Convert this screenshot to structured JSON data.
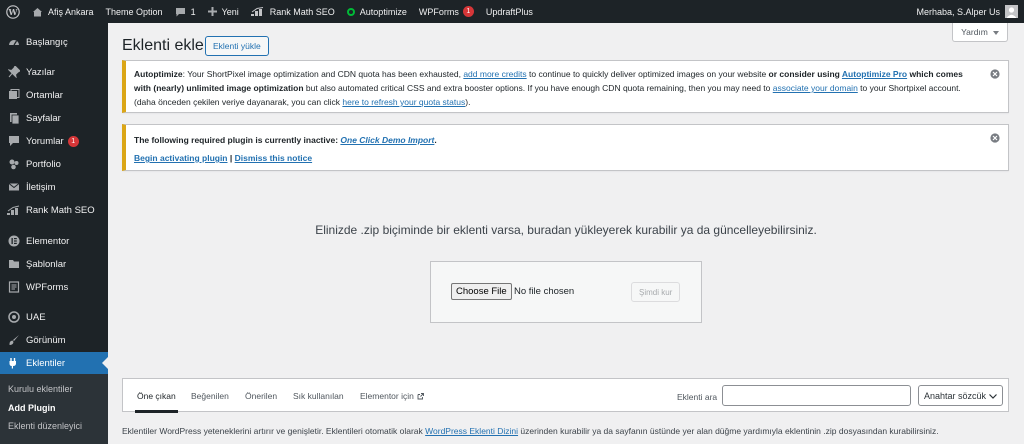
{
  "colors": {
    "admin_bar_bg": "#1d2327",
    "sidebar_bg": "#1d2327",
    "submenu_bg": "#2c3338",
    "accent": "#2271b1",
    "notice_warning": "#dba617",
    "bubble": "#d63638",
    "content_bg": "#f0f0f1"
  },
  "admin_bar": {
    "items": [
      {
        "label": "",
        "icon": "wordpress-logo-icon"
      },
      {
        "label": "Afiş Ankara",
        "icon": "home-icon"
      },
      {
        "label": "Theme Option",
        "icon": ""
      },
      {
        "label": "1",
        "icon": "comment-icon"
      },
      {
        "label": "Yeni",
        "icon": "plus-icon"
      },
      {
        "label": "Rank Math SEO",
        "icon": "rank-math-icon"
      },
      {
        "label": "Autoptimize",
        "icon": "status-dot-icon"
      },
      {
        "label": "WPForms",
        "icon": "",
        "badge": "1"
      },
      {
        "label": "UpdraftPlus",
        "icon": ""
      }
    ],
    "greeting": "Merhaba, S.Alper Us"
  },
  "sidebar": {
    "items": [
      {
        "label": "Başlangıç",
        "icon": "dashboard-icon"
      },
      {
        "label": "Yazılar",
        "icon": "pin-icon"
      },
      {
        "label": "Ortamlar",
        "icon": "media-icon"
      },
      {
        "label": "Sayfalar",
        "icon": "pages-icon"
      },
      {
        "label": "Yorumlar",
        "icon": "comment-icon",
        "badge": "1"
      },
      {
        "label": "Portfolio",
        "icon": "portfolio-icon"
      },
      {
        "label": "İletişim",
        "icon": "mail-icon"
      },
      {
        "label": "Rank Math SEO",
        "icon": "rank-math-icon"
      },
      {
        "label": "Elementor",
        "icon": "elementor-icon"
      },
      {
        "label": "Şablonlar",
        "icon": "folder-icon"
      },
      {
        "label": "WPForms",
        "icon": "forms-icon"
      },
      {
        "label": "UAE",
        "icon": "uae-icon"
      },
      {
        "label": "Görünüm",
        "icon": "brush-icon"
      },
      {
        "label": "Eklentiler",
        "icon": "plugin-icon",
        "active": true
      }
    ],
    "submenu": [
      {
        "label": "Kurulu eklentiler"
      },
      {
        "label": "Add Plugin",
        "current": true
      },
      {
        "label": "Eklenti düzenleyici"
      }
    ]
  },
  "main": {
    "help_label": "Yardım",
    "title": "Eklenti ekle",
    "upload_toggle_label": "Eklenti yükle",
    "notice_autoptimize": {
      "brand": "Autoptimize",
      "t1": ": Your ShortPixel image optimization and CDN quota has been exhausted, ",
      "link1": "add more credits",
      "t2": " to continue to quickly deliver optimized images on your website ",
      "b1": "or consider using ",
      "link2": "Autoptimize Pro",
      "b2": " which comes with (nearly) unlimited image optimization",
      "t3": " but also automated critical CSS and extra booster options. If you have enough CDN quota remaining, then you may need to ",
      "link3": "associate your domain",
      "t4": " to your Shortpixel account.",
      "t5": "(daha önceden çekilen veriye dayanarak, you can click ",
      "link4": "here to refresh your quota status",
      "t6": ")."
    },
    "notice_plugin": {
      "text": "The following required plugin is currently inactive: ",
      "plugin_link": "One Click Demo Import",
      "period": ".",
      "begin_link": "Begin activating plugin",
      "separator": " | ",
      "dismiss_link": "Dismiss this notice"
    },
    "upload": {
      "help_text": "Elinizde .zip biçiminde bir eklenti varsa, buradan yükleyerek kurabilir ya da güncelleyebilirsiniz.",
      "choose_file_label": "Choose File",
      "file_status": "No file chosen",
      "install_label": "Şimdi kur"
    },
    "filter": {
      "tabs": [
        {
          "label": "Öne çıkan",
          "current": true
        },
        {
          "label": "Beğenilen"
        },
        {
          "label": "Önerilen"
        },
        {
          "label": "Sık kullanılan"
        },
        {
          "label": "Elementor için",
          "external": true
        }
      ],
      "search_label": "Eklenti ara",
      "search_value": "",
      "search_type": "Anahtar sözcük"
    },
    "footer": {
      "t1": "Eklentiler WordPress yeteneklerini artırır ve genişletir. Eklentileri otomatik olarak ",
      "link": "WordPress Eklenti Dizini",
      "t2": " üzerinden kurabilir ya da sayfanın üstünde yer alan düğme yardımıyla eklentinin .zip dosyasından kurabilirsiniz."
    }
  }
}
